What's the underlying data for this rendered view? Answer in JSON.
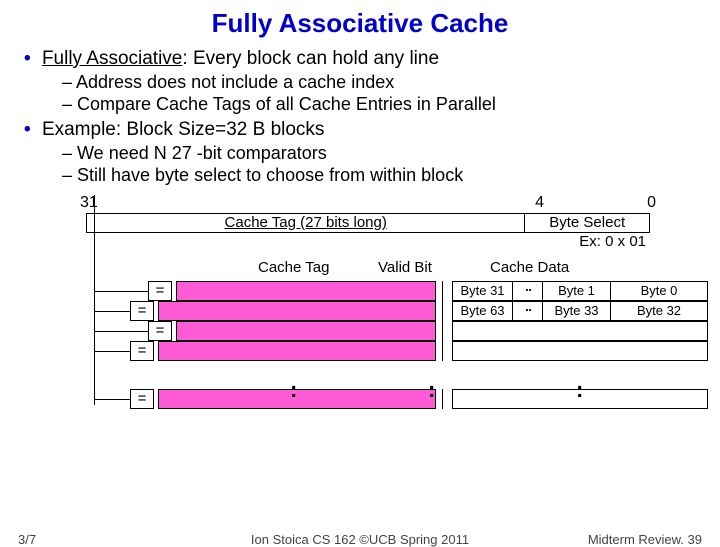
{
  "title": "Fully Associative Cache",
  "bullets": {
    "b1": "Fully Associative",
    "b1_rest": ": Every block can hold any line",
    "b1a": "– Address does not include a cache index",
    "b1b": "– Compare Cache Tags of all Cache Entries in Parallel",
    "b2": "Example: Block Size=32 B blocks",
    "b2a": "– We need N 27 -bit comparators",
    "b2b": "– Still have byte select to choose from within block"
  },
  "bits": {
    "hi": "31",
    "mid": "4",
    "lo": "0",
    "tag_label": "Cache Tag (27 bits long)",
    "bs_label": "Byte Select",
    "bs_example": "Ex: 0 x 01"
  },
  "headers": {
    "tag": "Cache Tag",
    "valid": "Valid Bit",
    "data": "Cache Data"
  },
  "eq": "=",
  "row1": {
    "c1": "Byte 31",
    "dots": ". .",
    "c2": "Byte 1",
    "c3": "Byte 0"
  },
  "row2": {
    "c1": "Byte 63",
    "dots": ". .",
    "c2": "Byte 33",
    "c3": "Byte 32"
  },
  "colon": ":",
  "footer": {
    "left": "3/7",
    "center": "Ion Stoica CS 162 ©UCB Spring 2011",
    "right": "Midterm Review. 39"
  }
}
